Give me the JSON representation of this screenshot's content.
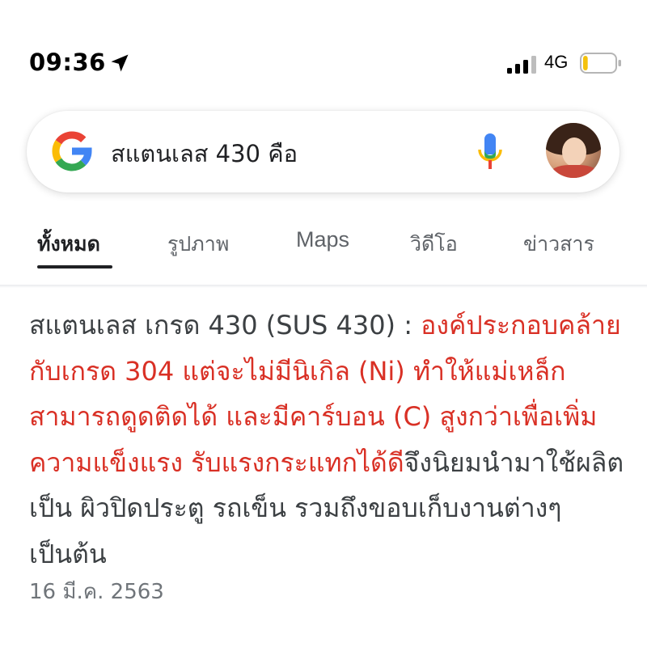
{
  "status_bar": {
    "time": "09:36",
    "network": "4G",
    "battery_level": 0.15,
    "battery_color": "#f4c20d"
  },
  "search": {
    "query": "สแตนเลส 430 คือ",
    "brand_colors": [
      "#4285F4",
      "#EA4335",
      "#FBBC05",
      "#34A853"
    ]
  },
  "tabs": [
    {
      "label": "ทั้งหมด",
      "active": true
    },
    {
      "label": "รูปภาพ",
      "active": false
    },
    {
      "label": "Maps",
      "active": false
    },
    {
      "label": "วิดีโอ",
      "active": false
    },
    {
      "label": "ข่าวสาร",
      "active": false
    }
  ],
  "result": {
    "prefix": "สแตนเลส เกรด 430 (SUS 430) : ",
    "highlight": "องค์ประกอบคล้ายกับเกรด 304 แต่จะไม่มีนิเกิล (Ni) ทำให้แม่เหล็กสามารถดูดติดได้ และมีคาร์บอน (C) สูงกว่าเพื่อเพิ่มความแข็งแรง รับแรงกระแทกได้ดี",
    "suffix": "จึงนิยมนำมาใช้ผลิตเป็น ผิวปิดประตู รถเข็น รวมถึงขอบเก็บงานต่างๆ เป็นต้น",
    "date": "16 มี.ค. 2563",
    "highlight_color": "#d93025"
  }
}
